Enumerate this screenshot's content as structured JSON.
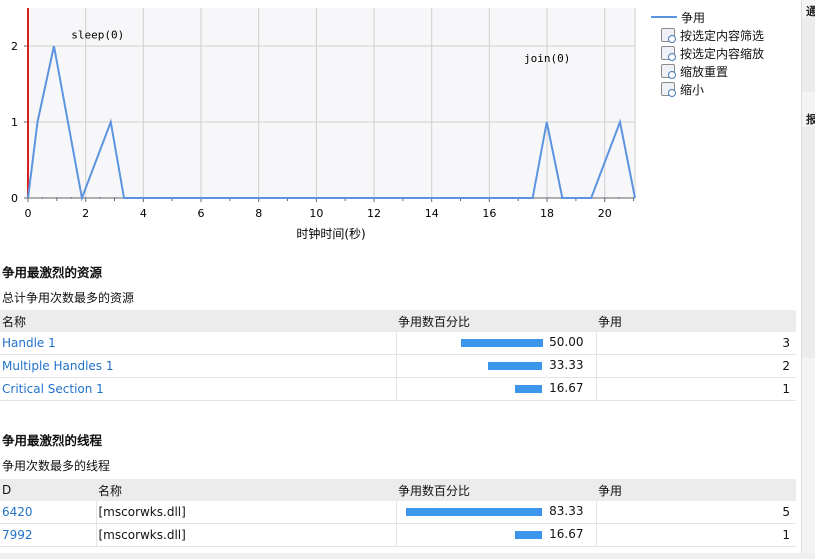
{
  "chart": {
    "xlabel": "时钟时间(秒)",
    "legend_label": "争用",
    "menu": [
      {
        "label": "按选定内容筛选",
        "icon": "filter-icon"
      },
      {
        "label": "按选定内容缩放",
        "icon": "zoom-selection-icon"
      },
      {
        "label": "缩放重置",
        "icon": "zoom-reset-icon"
      },
      {
        "label": "缩小",
        "icon": "zoom-out-icon"
      }
    ]
  },
  "chart_data": {
    "type": "line",
    "x": [
      0,
      0.33,
      0.9,
      1.87,
      2.87,
      3.33,
      17.5,
      17.99,
      18.53,
      19.53,
      20.53,
      21.05
    ],
    "series": [
      {
        "name": "争用",
        "values": [
          0,
          1,
          2,
          0,
          1,
          0,
          0,
          1,
          0,
          0,
          1,
          0
        ]
      }
    ],
    "xlim": [
      0,
      21.05
    ],
    "ylim": [
      0,
      2.5
    ],
    "xticks": [
      0,
      2,
      4,
      6,
      8,
      10,
      12,
      14,
      16,
      18,
      20
    ],
    "yticks": [
      0,
      1,
      2
    ],
    "xlabel": "时钟时间(秒)",
    "annotations": [
      {
        "text": "sleep(0)",
        "x": 1.5,
        "y": 2.1
      },
      {
        "text": "join(0)",
        "x": 17.2,
        "y": 1.79
      }
    ],
    "grid": true,
    "colors": {
      "line": "#5c94e0",
      "marker": "#d42020",
      "grid": "#cfcfcf",
      "axis": "#666666"
    }
  },
  "resources": {
    "title": "争用最激烈的资源",
    "subtitle": "总计争用次数最多的资源",
    "headers": {
      "name": "名称",
      "percent": "争用数百分比",
      "count": "争用"
    },
    "rows": [
      {
        "name": "Handle 1",
        "percent": "50.00",
        "fraction": 0.5,
        "count": "3"
      },
      {
        "name": "Multiple Handles 1",
        "percent": "33.33",
        "fraction": 0.3333,
        "count": "2"
      },
      {
        "name": "Critical Section 1",
        "percent": "16.67",
        "fraction": 0.1667,
        "count": "1"
      }
    ]
  },
  "threads": {
    "title": "争用最激烈的线程",
    "subtitle": "争用次数最多的线程",
    "headers": {
      "id": "D",
      "name": "名称",
      "percent": "争用数百分比",
      "count": "争用"
    },
    "rows": [
      {
        "id": "6420",
        "name": "[mscorwks.dll]",
        "percent": "83.33",
        "fraction": 0.8333,
        "count": "5"
      },
      {
        "id": "7992",
        "name": "[mscorwks.dll]",
        "percent": "16.67",
        "fraction": 0.1667,
        "count": "1"
      }
    ]
  },
  "right_strip": {
    "top_label": "通",
    "mid_label": "报"
  }
}
